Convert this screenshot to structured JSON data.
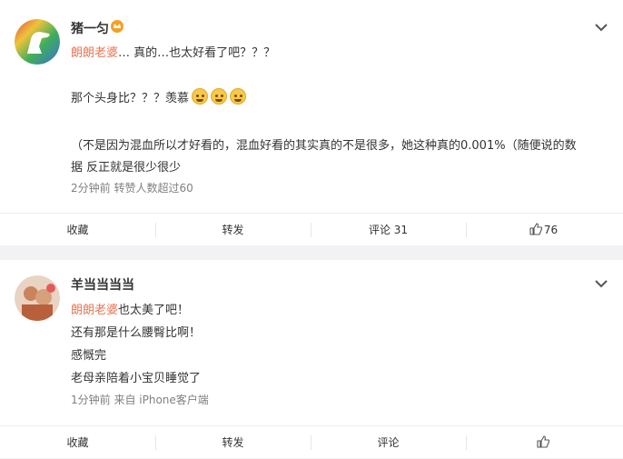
{
  "posts": [
    {
      "username": "猪一匀",
      "mention": "朗朗老婆",
      "lines": [
        "… 真的…也太好看了吧？？？",
        "那个头身比？？？羡慕",
        "（不是因为混血所以才好看的，混血好看的其实真的不是很多，她这种真的0.001%（随便说的数",
        "据 反正就是很少很少"
      ],
      "meta": "2分钟前 转赞人数超过60",
      "actions": {
        "collect": "收藏",
        "forward": "转发",
        "comment": "评论 31",
        "like": "76"
      }
    },
    {
      "username": "羊当当当当",
      "mention": "朗朗老婆",
      "lines": [
        "也太美了吧！",
        "还有那是什么腰臀比啊！",
        "感慨完",
        "老母亲陪着小宝贝睡觉了"
      ],
      "meta": "1分钟前 来自 iPhone客户端",
      "actions": {
        "collect": "收藏",
        "forward": "转发",
        "comment": "评论",
        "like": ""
      }
    }
  ],
  "icons": {
    "crown": "crown-icon",
    "chevron": "chevron-down-icon",
    "emoji": "crying-emoji-icon",
    "like": "thumbs-up-icon"
  },
  "colors": {
    "mention": "#eb7350",
    "meta": "#808080",
    "background": "#f2f2f5"
  }
}
